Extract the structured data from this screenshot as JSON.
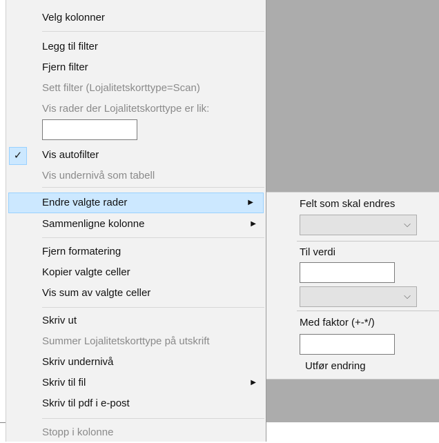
{
  "menu": {
    "items": [
      {
        "label": "Velg kolonner"
      },
      {
        "label": "Legg til filter"
      },
      {
        "label": "Fjern filter"
      },
      {
        "label": "Sett filter (Lojalitetskorttype=Scan)"
      },
      {
        "label": "Vis rader der Lojalitetskorttype er lik:"
      },
      {
        "label": "Vis autofilter"
      },
      {
        "label": "Vis undernivå som tabell"
      },
      {
        "label": "Endre valgte rader"
      },
      {
        "label": "Sammenligne kolonne"
      },
      {
        "label": "Fjern formatering"
      },
      {
        "label": "Kopier valgte celler"
      },
      {
        "label": "Vis sum av valgte celler"
      },
      {
        "label": "Skriv ut"
      },
      {
        "label": "Summer Lojalitetskorttype på utskrift"
      },
      {
        "label": "Skriv undernivå"
      },
      {
        "label": "Skriv til fil"
      },
      {
        "label": "Skriv til pdf i e-post"
      },
      {
        "label": "Stopp i kolonne"
      }
    ],
    "filter_value": "",
    "check_glyph": "✓",
    "submenu_arrow": "▶"
  },
  "submenu": {
    "field_label": "Felt som skal endres",
    "field_value": "",
    "to_value_label": "Til verdi",
    "to_value": "",
    "to_value_select": "",
    "factor_label": "Med faktor (+-*/)",
    "factor_value": "",
    "apply_label": "Utfør endring",
    "chevron": "⌵"
  },
  "colors": {
    "highlight": "#cce8ff",
    "highlight_border": "#99d1ff",
    "background_gray": "#acacac"
  }
}
